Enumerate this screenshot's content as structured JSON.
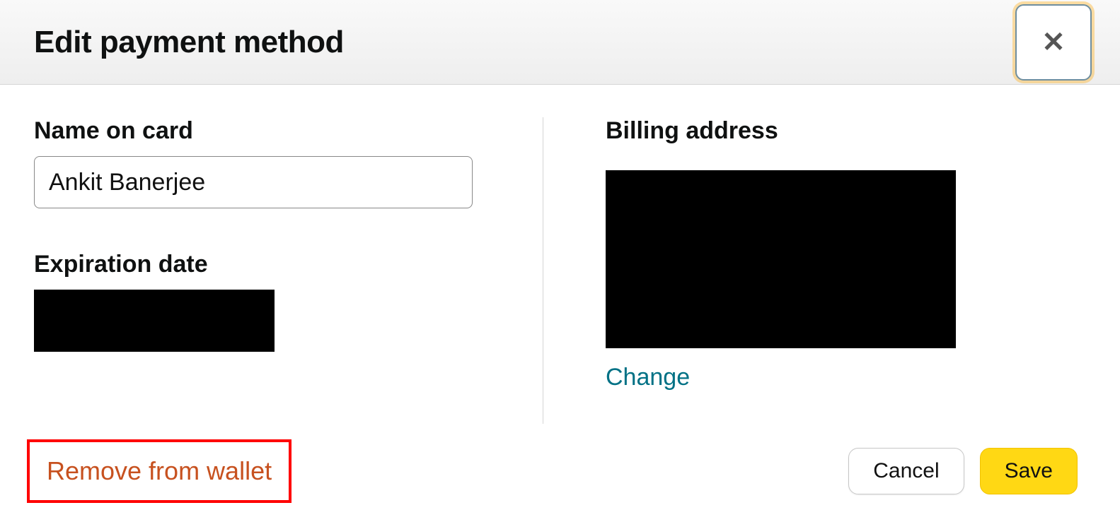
{
  "header": {
    "title": "Edit payment method",
    "close_glyph": "✕"
  },
  "left": {
    "name_label": "Name on card",
    "name_value": "Ankit Banerjee",
    "exp_label": "Expiration date"
  },
  "right": {
    "address_label": "Billing address",
    "change_label": "Change"
  },
  "footer": {
    "remove_label": "Remove from wallet",
    "cancel_label": "Cancel",
    "save_label": "Save"
  }
}
